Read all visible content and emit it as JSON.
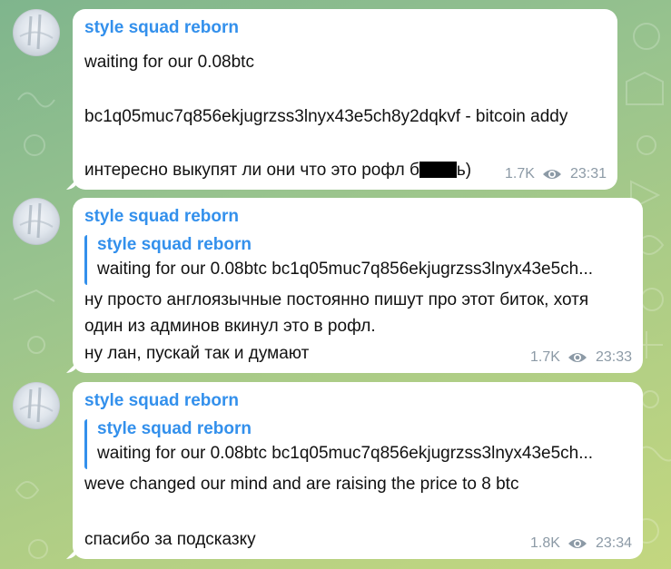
{
  "messages": [
    {
      "sender": "style squad reborn",
      "lines": [
        "waiting for our 0.08btc",
        "bc1q05muc7q856ekjugrzss3lnyx43e5ch8y2dqkvf - bitcoin addy"
      ],
      "last_line_before": "интересно выкупят ли они что это рофл б",
      "last_line_after": "ь)",
      "views": "1.7K",
      "time": "23:31"
    },
    {
      "sender": "style squad reborn",
      "reply": {
        "sender": "style squad reborn",
        "text": "waiting for our 0.08btc bc1q05muc7q856ekjugrzss3lnyx43e5ch..."
      },
      "lines": [
        "ну просто англоязычные постоянно пишут про этот биток, хотя",
        "один из админов вкинул это в рофл.",
        "ну лан, пускай так и думают"
      ],
      "views": "1.7K",
      "time": "23:33"
    },
    {
      "sender": "style squad reborn",
      "reply": {
        "sender": "style squad reborn",
        "text": "waiting for our 0.08btc bc1q05muc7q856ekjugrzss3lnyx43e5ch..."
      },
      "lines": [
        "weve changed our mind and are raising the price to 8 btc",
        "спасибо за подсказку"
      ],
      "views": "1.8K",
      "time": "23:34"
    }
  ],
  "colors": {
    "accent": "#3390ec",
    "meta": "#8c9aa6",
    "bubble": "#ffffff"
  },
  "icons": {
    "views": "eye-icon",
    "avatar": "channel-avatar"
  }
}
